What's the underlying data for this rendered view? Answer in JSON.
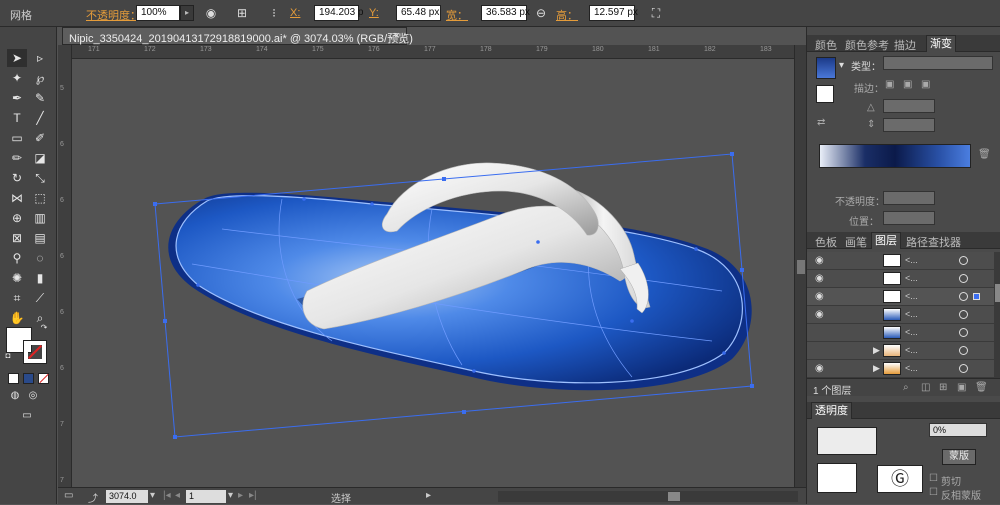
{
  "control_bar": {
    "mesh_label": "网格",
    "opacity_label": "不透明度：",
    "opacity_value": "100%",
    "x_label": "X:",
    "x_value": "194.203 p",
    "y_label": "Y:",
    "y_value": "65.48 px",
    "w_label": "宽：",
    "w_value": "36.583 px",
    "h_label": "高：",
    "h_value": "12.597 px"
  },
  "document": {
    "tab_title": "Nipic_3350424_20190413172918819000.ai* @ 3074.03% (RGB/预览)",
    "close": "×"
  },
  "ruler": {
    "h_ticks": [
      "171",
      "172",
      "173",
      "174",
      "175",
      "176",
      "177",
      "178",
      "179",
      "180",
      "181",
      "182",
      "183"
    ],
    "v_ticks": [
      "5",
      "6",
      "6",
      "6",
      "6",
      "6",
      "7",
      "7"
    ]
  },
  "status_bar": {
    "zoom": "3074.0",
    "page": "1",
    "mode": "选择"
  },
  "panel_top": {
    "tabs": [
      "颜色",
      "颜色参考",
      "描边",
      "渐变"
    ],
    "active_tab": "渐变",
    "type_label": "类型：",
    "stroke_label": "描边：",
    "opacity_label": "不透明度：",
    "position_label": "位置："
  },
  "panel_layers": {
    "tabs": [
      "色板",
      "画笔",
      "图层",
      "路径查找器"
    ],
    "active_tab": "图层",
    "count_label": "1 个图层",
    "rows": [
      {
        "name": "<..."
      },
      {
        "name": "<..."
      },
      {
        "name": "<..."
      },
      {
        "name": "<..."
      },
      {
        "name": "<..."
      },
      {
        "name": "<..."
      },
      {
        "name": "<..."
      }
    ]
  },
  "panel_transparency": {
    "title": "透明度",
    "opacity_value": "0%",
    "mask_button": "蒙版",
    "clip_label": "剪切",
    "invert_label": "反相蒙版"
  },
  "colors": {
    "accent_orange": "#e59c3a",
    "sole_blue": "#2f6fd6",
    "path_blue": "#3a6df0"
  }
}
